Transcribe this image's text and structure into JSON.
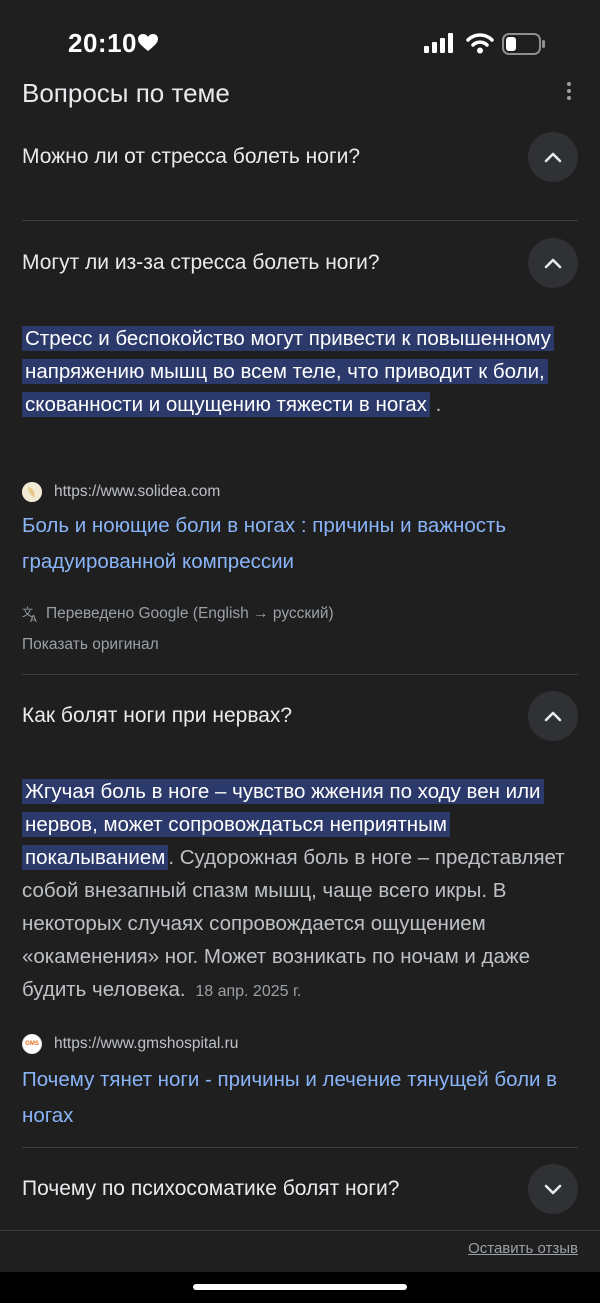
{
  "status_bar": {
    "time": "20:10"
  },
  "section": {
    "title": "Вопросы по теме"
  },
  "questions": [
    {
      "text": "Можно ли от стресса болеть ноги?",
      "state": "expanded"
    },
    {
      "text": "Могут ли из-за стресса болеть ноги?",
      "state": "expanded",
      "answer_highlight": "Стресс и беспокойство могут привести к повышенному напряжению мышц во всем теле, что приводит к боли, скованности и ощущению тяжести в ногах",
      "answer_rest": " .",
      "source_url": "https://www.solidea.com",
      "link_title": "Боль и ноющие боли в ногах : причины и важность градуированной компрессии",
      "translated_note": "Переведено Google (English → русский)",
      "show_original": "Показать оригинал"
    },
    {
      "text": "Как болят ноги при нервах?",
      "state": "expanded",
      "answer_highlight": "Жгучая боль в ноге – чувство жжения по ходу вен или нервов, может сопровождаться неприятным покалыванием",
      "answer_rest": ". Судорожная боль в ноге – представляет собой внезапный спазм мышц, чаще всего икры. В некоторых случаях сопровождается ощущением «окаменения» ног. Может возникать по ночам и даже будить человека.",
      "date": "18 апр. 2025 г.",
      "source_url": "https://www.gmshospital.ru",
      "source_favicon_text": "GMS",
      "link_title": "Почему тянет ноги - причины и лечение тянущей боли в ногах"
    },
    {
      "text": "Почему по психосоматике болят ноги?",
      "state": "collapsed"
    }
  ],
  "footer": {
    "feedback": "Оставить отзыв"
  },
  "colors": {
    "background": "#1f1f1f",
    "highlight": "#2c3a6b",
    "link": "#8ab4f8",
    "chip": "#303134"
  }
}
